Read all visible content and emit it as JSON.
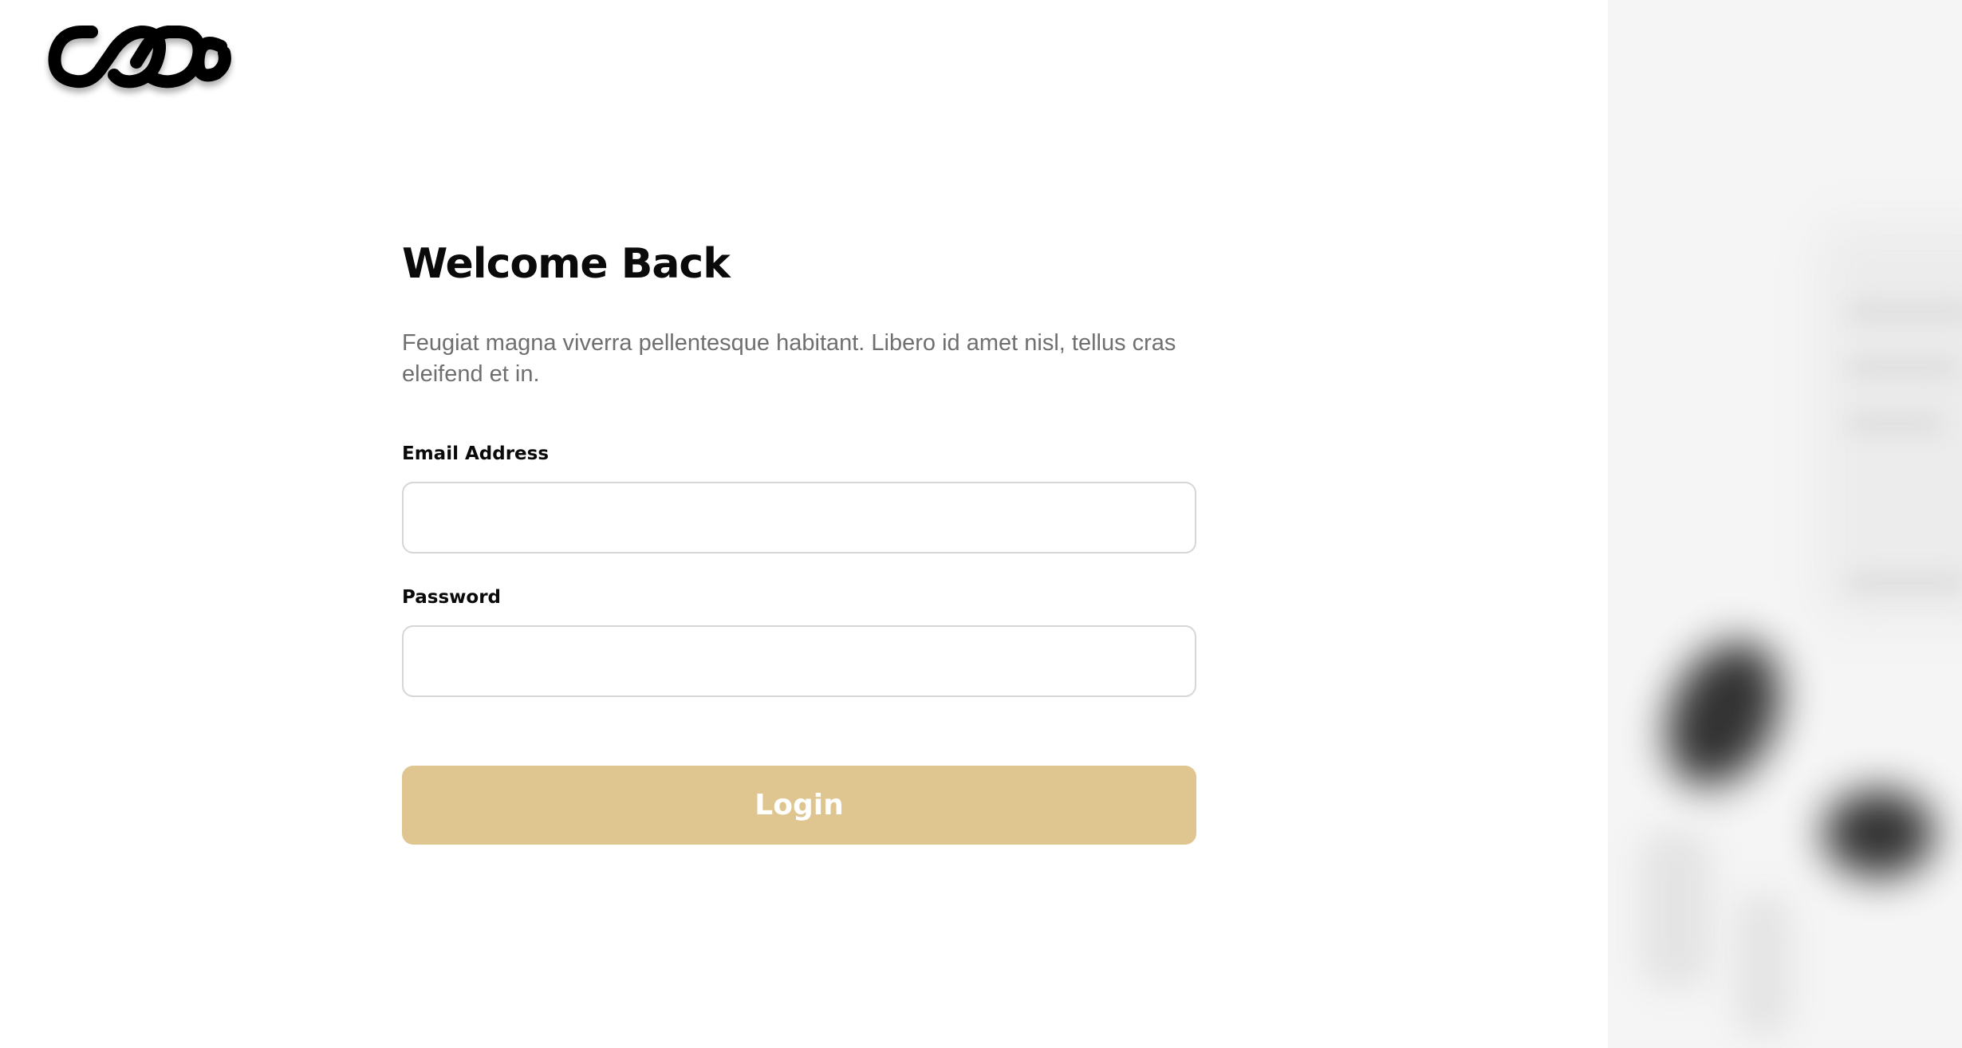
{
  "brand": {
    "logo_icon": "chain-link-logo"
  },
  "login": {
    "title": "Welcome Back",
    "subtitle": "Feugiat magna viverra pellentesque habitant. Libero id amet nisl, tellus cras eleifend et in.",
    "email_label": "Email Address",
    "email_value": "",
    "email_placeholder": "",
    "password_label": "Password",
    "password_value": "",
    "password_placeholder": "",
    "button_label": "Login"
  },
  "colors": {
    "accent": "#dfc690",
    "text_primary": "#0a0a0a",
    "text_secondary": "#6f6f6f",
    "input_border": "#d6d6d6",
    "side_panel_bg": "#f5f5f5"
  }
}
